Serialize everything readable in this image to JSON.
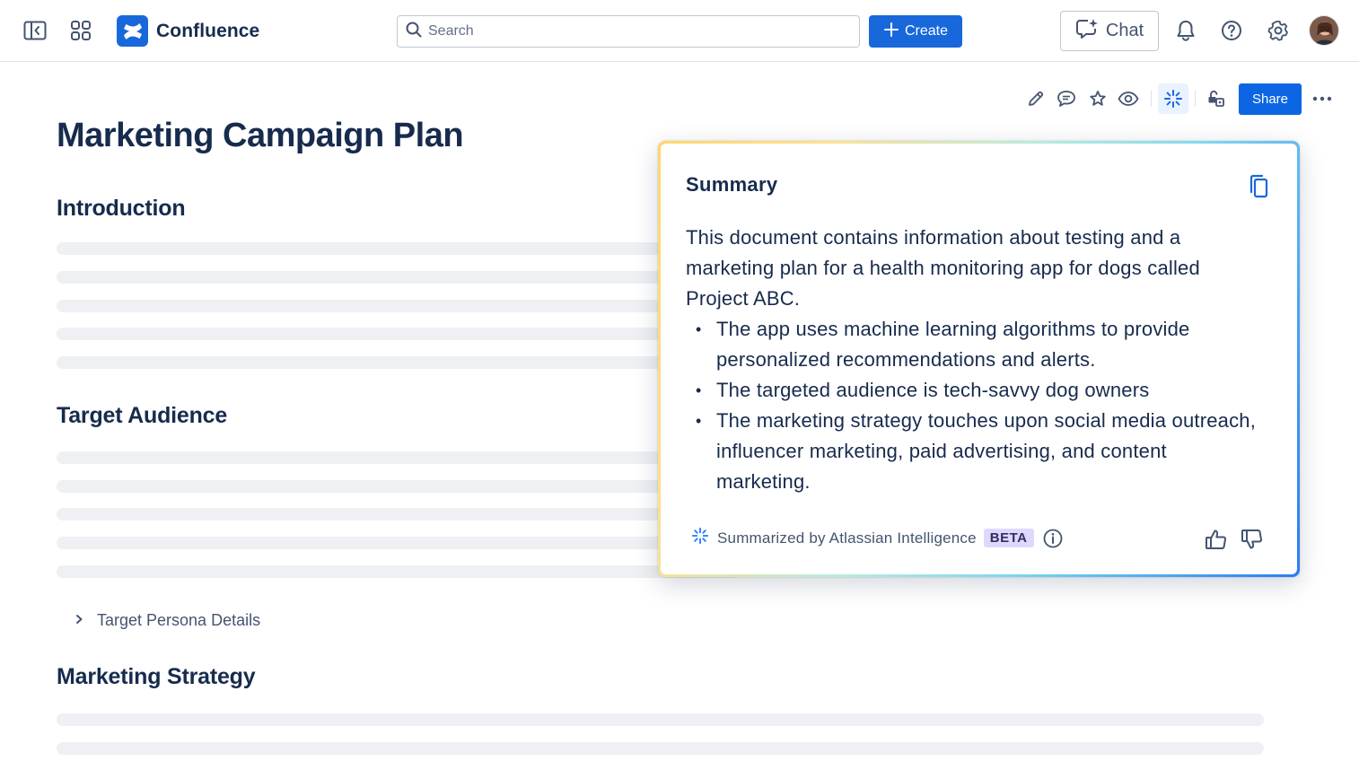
{
  "topbar": {
    "app_name": "Confluence",
    "search_placeholder": "Search",
    "create_label": "Create",
    "chat_label": "Chat",
    "icons": [
      "sidebar-toggle-icon",
      "app-switcher-icon",
      "confluence-logo-icon",
      "search-icon",
      "plus-icon",
      "chat-sparkle-icon",
      "bell-icon",
      "help-icon",
      "gear-icon"
    ]
  },
  "page_toolbar": {
    "share_label": "Share",
    "icons": [
      "pencil-icon",
      "comment-icon",
      "star-icon",
      "eye-icon",
      "ai-sparkle-icon",
      "restrictions-icon",
      "more-icon"
    ]
  },
  "document": {
    "title": "Marketing Campaign Plan",
    "sections": {
      "introduction": "Introduction",
      "target_audience": "Target Audience",
      "marketing_strategy": "Marketing Strategy"
    },
    "expand_label": "Target Persona Details"
  },
  "summary": {
    "title": "Summary",
    "intro": "This document contains information about testing and a marketing plan for a health monitoring app for dogs called Project ABC.",
    "bullets": [
      "The app uses machine learning algorithms to provide personalized recommendations and alerts.",
      "The targeted audience is tech-savvy dog owners",
      "The marketing strategy touches upon social media outreach, influencer marketing, paid advertising, and content marketing."
    ],
    "footer_label": "Summarized by Atlassian Intelligence",
    "badge": "BETA"
  },
  "colors": {
    "brand_blue": "#1868db",
    "share_blue": "#0c66e4",
    "text": "#172b4d",
    "subtle_text": "#44546f",
    "placeholder_line": "#eef0f3",
    "beta_bg": "#dfd8fd"
  }
}
